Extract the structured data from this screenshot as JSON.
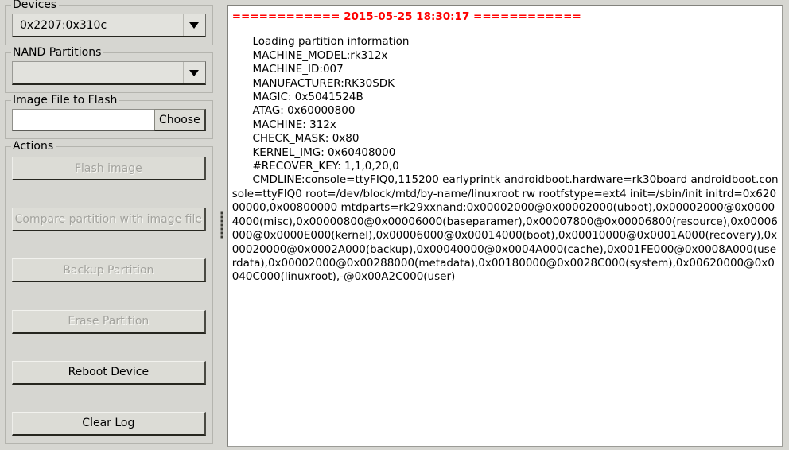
{
  "devices": {
    "group_label": "Devices",
    "selected": "0x2207:0x310c",
    "arrow_icon": "chevron-down-icon"
  },
  "nand_partitions": {
    "group_label": "NAND Partitions",
    "selected": "",
    "arrow_icon": "chevron-down-icon"
  },
  "image_file": {
    "group_label": "Image File to Flash",
    "path_value": "",
    "path_placeholder": "",
    "choose_label": "Choose"
  },
  "actions": {
    "group_label": "Actions",
    "buttons": [
      {
        "label": "Flash image",
        "enabled": false
      },
      {
        "label": "Compare partition with image file",
        "enabled": false
      },
      {
        "label": "Backup Partition",
        "enabled": false
      },
      {
        "label": "Erase Partition",
        "enabled": false
      },
      {
        "label": "Reboot Device",
        "enabled": true
      },
      {
        "label": "Clear Log",
        "enabled": true
      }
    ]
  },
  "splitter": {
    "name": "pane-splitter"
  },
  "log": {
    "timestamp_line": "============ 2015-05-25 18:30:17 ============",
    "timestamp_color": "#ff0000",
    "text": "      Loading partition information\n      MACHINE_MODEL:rk312x\n      MACHINE_ID:007\n      MANUFACTURER:RK30SDK\n      MAGIC: 0x5041524B\n      ATAG: 0x60000800\n      MACHINE: 312x\n      CHECK_MASK: 0x80\n      KERNEL_IMG: 0x60408000\n      #RECOVER_KEY: 1,1,0,20,0\n      CMDLINE:console=ttyFIQ0,115200 earlyprintk androidboot.hardware=rk30board androidboot.console=ttyFIQ0 root=/dev/block/mtd/by-name/linuxroot rw rootfstype=ext4 init=/sbin/init initrd=0x62000000,0x00800000 mtdparts=rk29xxnand:0x00002000@0x00002000(uboot),0x00002000@0x00004000(misc),0x00000800@0x00006000(baseparamer),0x00007800@0x00006800(resource),0x00006000@0x0000E000(kernel),0x00006000@0x00014000(boot),0x00010000@0x0001A000(recovery),0x00020000@0x0002A000(backup),0x00040000@0x0004A000(cache),0x001FE000@0x0008A000(userdata),0x00002000@0x00288000(metadata),0x00180000@0x0028C000(system),0x00620000@0x0040C000(linuxroot),-@0x00A2C000(user)"
  },
  "colors": {
    "window_background": "#d6d6d1",
    "control_background": "#dcdcd6",
    "log_background": "#ffffff",
    "disabled_text": "#a3a39e",
    "accent_red": "#ff0000"
  }
}
